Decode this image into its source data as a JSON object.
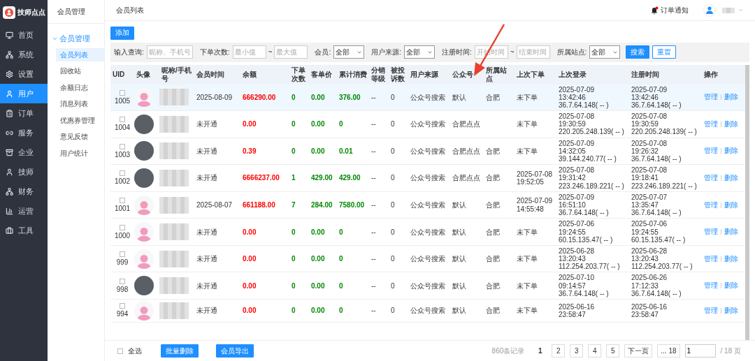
{
  "brand": {
    "name": "技师点点"
  },
  "sidebar": {
    "items": [
      {
        "label": "首页",
        "selected": false
      },
      {
        "label": "系统",
        "selected": false
      },
      {
        "label": "设置",
        "selected": false
      },
      {
        "label": "用户",
        "selected": true
      },
      {
        "label": "订单",
        "selected": false
      },
      {
        "label": "服务",
        "selected": false
      },
      {
        "label": "企业",
        "selected": false
      },
      {
        "label": "技师",
        "selected": false
      },
      {
        "label": "财务",
        "selected": false
      },
      {
        "label": "运营",
        "selected": false
      },
      {
        "label": "工具",
        "selected": false
      }
    ]
  },
  "subnav": {
    "title": "会员管理",
    "group": {
      "label": "会员管理",
      "expanded": true
    },
    "items": [
      {
        "label": "会员列表",
        "selected": true
      },
      {
        "label": "回收站",
        "selected": false
      },
      {
        "label": "余额日志",
        "selected": false
      },
      {
        "label": "消息列表",
        "selected": false
      },
      {
        "label": "优惠券管理",
        "selected": false
      },
      {
        "label": "意见反馈",
        "selected": false
      },
      {
        "label": "用户统计",
        "selected": false
      }
    ]
  },
  "topbar": {
    "breadcrumb": "会员列表",
    "notice": "订单通知",
    "notice_dot": true
  },
  "add_button": "添加",
  "filters": [
    {
      "kind": "text",
      "label": "输入查询:",
      "placeholders": [
        "昵称、手机号"
      ]
    },
    {
      "kind": "range",
      "label": "下单次数:",
      "placeholders": [
        "最小值",
        "最大值"
      ],
      "separator": "~"
    },
    {
      "kind": "select",
      "label": "会员:",
      "value": "全部"
    },
    {
      "kind": "select",
      "label": "用户来源:",
      "value": "全部"
    },
    {
      "kind": "range",
      "label": "注册时间:",
      "placeholders": [
        "开始时间",
        "结束时间"
      ],
      "separator": "~"
    },
    {
      "kind": "select",
      "label": "所属站点:",
      "value": "全部"
    }
  ],
  "filter_buttons": {
    "search": "搜索",
    "reset": "重置"
  },
  "table": {
    "columns": [
      "UID",
      "头像",
      "昵称/手机号",
      "会员时间",
      "余额",
      "下单次数",
      "客单价",
      "累计消费",
      "分销等级",
      "被投诉数",
      "用户来源",
      "公众号",
      "所属站点",
      "上次下单",
      "上次登录",
      "注册时间",
      "操作"
    ],
    "rows": [
      {
        "selected": true,
        "checked": false,
        "uid": "1005",
        "kind": "default-avatar",
        "member_time": "2025-08-09",
        "balance": "666290.00",
        "orders": "0",
        "avg": "0.00",
        "total": "376.00",
        "dist": "--",
        "complaints": "0",
        "source": "公众号搜索",
        "account": "默认",
        "site": "合肥",
        "last_order": [
          "未下单"
        ],
        "last_login": [
          "2025-07-09",
          "13:42:46",
          "36.7.64.148( -- )"
        ],
        "registered": [
          "2025-07-09",
          "13:42:46",
          "36.7.64.148( -- )"
        ],
        "actions": [
          "管理",
          "删除"
        ]
      },
      {
        "selected": false,
        "checked": false,
        "uid": "1004",
        "kind": "photo",
        "member_time": "未开通",
        "balance": "0.00",
        "orders": "0",
        "avg": "0.00",
        "total": "0",
        "dist": "--",
        "complaints": "0",
        "source": "公众号搜索",
        "account": "合肥点点",
        "site": "",
        "last_order": [
          "未下单"
        ],
        "last_login": [
          "2025-07-08",
          "19:30:59",
          "220.205.248.139( -- )"
        ],
        "registered": [
          "2025-07-08",
          "19:30:59",
          "220.205.248.139( -- )"
        ],
        "actions": [
          "管理",
          "删除"
        ]
      },
      {
        "selected": false,
        "checked": false,
        "uid": "1003",
        "kind": "photo",
        "member_time": "未开通",
        "balance": "0.39",
        "orders": "0",
        "avg": "0.00",
        "total": "0.01",
        "dist": "--",
        "complaints": "0",
        "source": "公众号搜索",
        "account": "合肥点点",
        "site": "合肥",
        "last_order": [
          "未下单"
        ],
        "last_login": [
          "2025-07-09",
          "14:32:05",
          "39.144.240.77( -- )"
        ],
        "registered": [
          "2025-07-08",
          "19:26:32",
          "36.7.64.148( -- )"
        ],
        "actions": [
          "管理",
          "删除"
        ]
      },
      {
        "selected": false,
        "checked": false,
        "uid": "1002",
        "kind": "photo",
        "member_time": "未开通",
        "balance": "6666237.00",
        "orders": "1",
        "avg": "429.00",
        "total": "429.00",
        "dist": "--",
        "complaints": "0",
        "source": "公众号搜索",
        "account": "合肥点点",
        "site": "合肥",
        "last_order": [
          "2025-07-08",
          "19:52:05"
        ],
        "last_login": [
          "2025-07-08",
          "19:31:42",
          "223.246.189.221( -- )"
        ],
        "registered": [
          "2025-07-08",
          "19:18:41",
          "223.246.189.221( -- )"
        ],
        "actions": [
          "管理",
          "删除"
        ]
      },
      {
        "selected": false,
        "checked": false,
        "uid": "1001",
        "kind": "default-avatar",
        "member_time": "2025-08-07",
        "balance": "661188.00",
        "orders": "7",
        "avg": "284.00",
        "total": "7580.00",
        "dist": "--",
        "complaints": "0",
        "source": "公众号搜索",
        "account": "默认",
        "site": "合肥",
        "last_order": [
          "2025-07-09",
          "14:55:48"
        ],
        "last_login": [
          "2025-07-09",
          "16:51:10",
          "36.7.64.148( -- )"
        ],
        "registered": [
          "2025-07-07",
          "13:35:47",
          "36.7.64.148( -- )"
        ],
        "actions": [
          "管理",
          "删除"
        ]
      },
      {
        "selected": false,
        "checked": false,
        "uid": "1000",
        "kind": "default-avatar",
        "member_time": "未开通",
        "balance": "0.00",
        "orders": "0",
        "avg": "0.00",
        "total": "0",
        "dist": "--",
        "complaints": "0",
        "source": "公众号搜索",
        "account": "默认",
        "site": "合肥",
        "last_order": [
          "未下单"
        ],
        "last_login": [
          "2025-07-06",
          "19:24:55",
          "60.15.135.47( -- )"
        ],
        "registered": [
          "2025-07-06",
          "19:24:55",
          "60.15.135.47( -- )"
        ],
        "actions": [
          "管理",
          "删除"
        ]
      },
      {
        "selected": false,
        "checked": false,
        "uid": "999",
        "kind": "default-avatar",
        "member_time": "未开通",
        "balance": "0.00",
        "orders": "0",
        "avg": "0.00",
        "total": "0",
        "dist": "--",
        "complaints": "0",
        "source": "公众号搜索",
        "account": "默认",
        "site": "合肥",
        "last_order": [
          "未下单"
        ],
        "last_login": [
          "2025-06-28",
          "13:20:43",
          "112.254.203.77( -- )"
        ],
        "registered": [
          "2025-06-28",
          "13:20:43",
          "112.254.203.77( -- )"
        ],
        "actions": [
          "管理",
          "删除"
        ]
      },
      {
        "selected": false,
        "checked": false,
        "uid": "998",
        "kind": "photo",
        "member_time": "未开通",
        "balance": "0.00",
        "orders": "0",
        "avg": "0.00",
        "total": "0",
        "dist": "--",
        "complaints": "0",
        "source": "公众号搜索",
        "account": "默认",
        "site": "合肥",
        "last_order": [
          "未下单"
        ],
        "last_login": [
          "2025-07-10",
          "09:14:57",
          "36.7.64.148( -- )"
        ],
        "registered": [
          "2025-06-26",
          "17:12:33",
          "36.7.64.148( -- )"
        ],
        "actions": [
          "管理",
          "删除"
        ]
      },
      {
        "selected": false,
        "checked": false,
        "uid": "994",
        "kind": "default-avatar",
        "member_time": "未开通",
        "balance": "0.00",
        "orders": "0",
        "avg": "0.00",
        "total": "0",
        "dist": "--",
        "complaints": "0",
        "source": "公众号搜索",
        "account": "默认",
        "site": "合肥",
        "last_order": [
          "未下单"
        ],
        "last_login": [
          "2025-06-16",
          "23:58:47"
        ],
        "registered": [
          "2025-06-16",
          "23:58:47"
        ],
        "actions": [
          "管理",
          "删除"
        ]
      }
    ]
  },
  "footer": {
    "select_all": {
      "label": "全选",
      "checked": false
    },
    "batch_delete": "批量删除",
    "export": "会员导出",
    "total": "860条记录",
    "pages": [
      {
        "label": "1",
        "selected": true
      },
      {
        "label": "2",
        "selected": false
      },
      {
        "label": "3",
        "selected": false
      },
      {
        "label": "4",
        "selected": false
      },
      {
        "label": "5",
        "selected": false
      }
    ],
    "next": "下一页",
    "last": "... 18",
    "page_input": "1",
    "page_count": "/ 18 页"
  }
}
